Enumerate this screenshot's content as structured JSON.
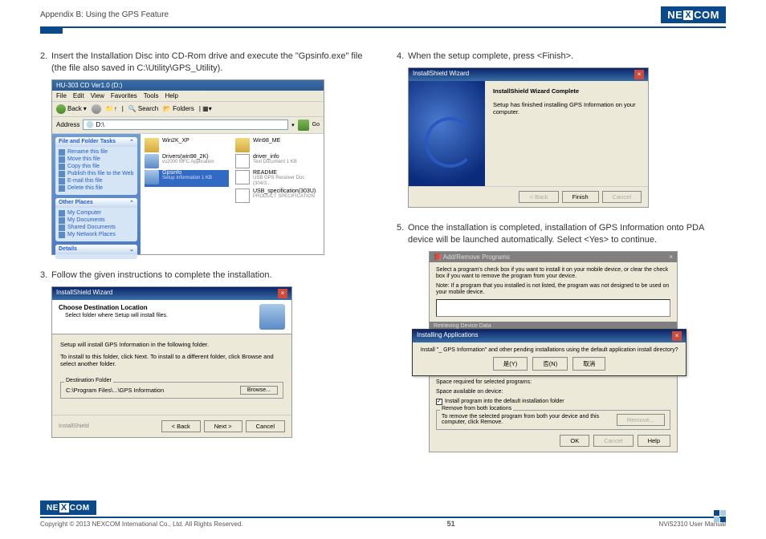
{
  "header": {
    "section": "Appendix B: Using the GPS Feature",
    "logo": "NEXCOM"
  },
  "steps": {
    "s2": {
      "num": "2.",
      "text": "Insert the Installation Disc into CD-Rom drive and execute the \"Gpsinfo.exe\" file (the file also saved in C:\\Utility\\GPS_Utility)."
    },
    "s3": {
      "num": "3.",
      "text": "Follow the given instructions to complete the installation."
    },
    "s4": {
      "num": "4.",
      "text": "When the setup complete, press <Finish>."
    },
    "s5": {
      "num": "5.",
      "text": "Once the installation is completed, installation of GPS Information onto PDA device will be launched automatically. Select <Yes> to continue."
    }
  },
  "shotA": {
    "title": "HU-303 CD Ver1.0 (D:)",
    "menu": [
      "File",
      "Edit",
      "View",
      "Favorites",
      "Tools",
      "Help"
    ],
    "tool_back": "Back",
    "tool_search": "Search",
    "tool_folders": "Folders",
    "addr_label": "Address",
    "addr_value": "D:\\",
    "side1": {
      "title": "File and Folder Tasks",
      "items": [
        "Rename this file",
        "Move this file",
        "Copy this file",
        "Publish this file to the Web",
        "E-mail this file",
        "Delete this file"
      ]
    },
    "side2": {
      "title": "Other Places",
      "items": [
        "My Computer",
        "My Documents",
        "Shared Documents",
        "My Network Places"
      ]
    },
    "side3": {
      "title": "Details"
    },
    "files": [
      {
        "name": "Win2K_XP",
        "sub": ""
      },
      {
        "name": "Win98_ME",
        "sub": ""
      },
      {
        "name": "Drivers(win98_2K)",
        "sub": "vs2000 MFC Application"
      },
      {
        "name": "driver_info",
        "sub": "Text Document\n1 KB"
      },
      {
        "name": "Gpsinfo",
        "sub": "Setup Information\n1 KB"
      },
      {
        "name": "README",
        "sub": "USB GPS Receiver Doc (304/3..."
      },
      {
        "name": "",
        "sub": ""
      },
      {
        "name": "USB_specification(303U)",
        "sub": "PRODUCT SPECIFICATION"
      }
    ]
  },
  "shotB": {
    "title": "InstallShield Wizard",
    "hdr1": "Choose Destination Location",
    "hdr2": "Select folder where Setup will install files.",
    "line1": "Setup will install GPS Information in the following folder.",
    "line2": "To install to this folder, click Next. To install to a different folder, click Browse and select another folder.",
    "dest_legend": "Destination Folder",
    "dest_path": "C:\\Program Files\\...\\GPS Information",
    "browse": "Browse...",
    "brand": "InstallShield",
    "back": "< Back",
    "next": "Next >",
    "cancel": "Cancel"
  },
  "shotC": {
    "title": "InstallShield Wizard",
    "h": "InstallShield Wizard Complete",
    "p": "Setup has finished installing GPS Information on your computer.",
    "back": "< Back",
    "finish": "Finish",
    "cancel": "Cancel"
  },
  "shotD": {
    "title": "Add/Remove Programs",
    "p1": "Select a program's check box if you want to install it on your mobile device, or clear the check box if you want to remove the program from your device.",
    "p2": "Note: If a program that you installed is not listed, the program was not designed to be used on your mobile device.",
    "sub": "Retrieving Device Data",
    "pop_title": "Installing Applications",
    "pop_msg": "Install \"_ GPS Information\" and other pending installations using the default application install directory?",
    "pop_yes": "是(Y)",
    "pop_no": "否(N)",
    "pop_cancel": "取消",
    "space1": "Space required for selected programs:",
    "space2": "Space available on device:",
    "chk": "Install program into the default installation folder",
    "rem_h": "Remove from both locations",
    "rem_p": "To remove the selected program from both your device and this computer, click Remove.",
    "remove": "Remove...",
    "ok": "OK",
    "cancel": "Cancel",
    "help": "Help"
  },
  "footer": {
    "logo": "NEXCOM",
    "copyright": "Copyright © 2013 NEXCOM International Co., Ltd. All Rights Reserved.",
    "page": "51",
    "doc": "NViS2310 User Manual"
  }
}
